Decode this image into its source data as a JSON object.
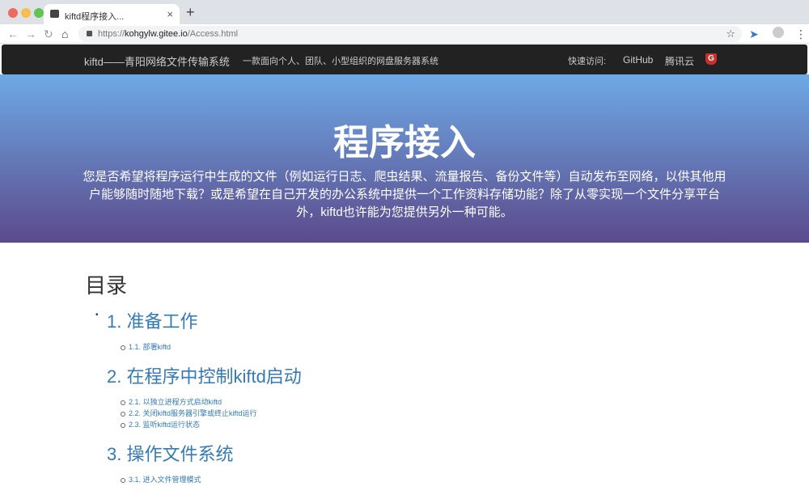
{
  "browser": {
    "tab_title": "kiftd程序接入...",
    "url_prefix": "https://",
    "url_host": "kohgylw.gitee.io",
    "url_path": "/Access.html"
  },
  "site_nav": {
    "brand": "kiftd——青阳网络文件传输系统",
    "tagline": "一款面向个人、团队、小型组织的网盘服务器系统",
    "quick_label": "快速访问:",
    "links": [
      "GitHub",
      "腾讯云"
    ],
    "gitee_icon": "G"
  },
  "hero": {
    "title": "程序接入",
    "text": "您是否希望将程序运行中生成的文件（例如运行日志、爬虫结果、流量报告、备份文件等）自动发布至网络，以供其他用户能够随时随地下载？或是希望在自己开发的办公系统中提供一个工作资料存储功能？除了从零实现一个文件分享平台外，kiftd也许能为您提供另外一种可能。"
  },
  "toc": {
    "heading": "目录",
    "sections": [
      {
        "title": "1. 准备工作",
        "items": [
          "1.1. 部署kiftd"
        ]
      },
      {
        "title": "2. 在程序中控制kiftd启动",
        "items": [
          "2.1. 以独立进程方式启动kiftd",
          "2.2. 关闭kiftd服务器引擎或终止kiftd运行",
          "2.3. 监听kiftd运行状态"
        ]
      },
      {
        "title": "3. 操作文件系统",
        "items": [
          "3.1. 进入文件管理模式"
        ]
      }
    ]
  }
}
